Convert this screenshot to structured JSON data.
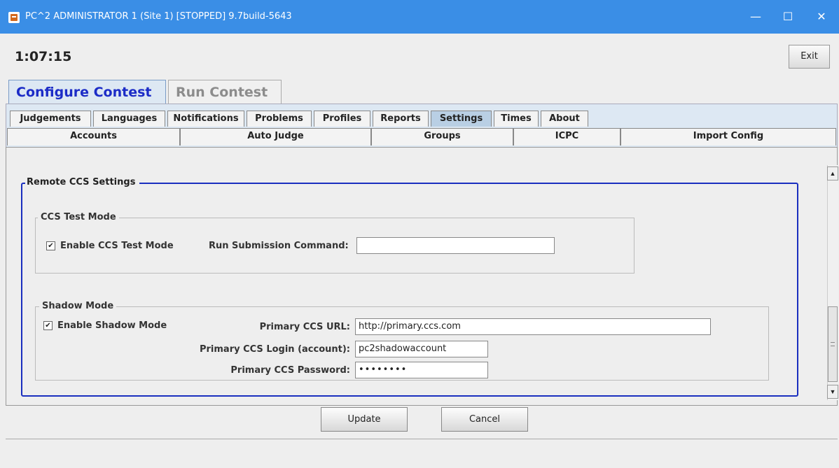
{
  "window": {
    "title": "PC^2 ADMINISTRATOR 1 (Site 1) [STOPPED] 9.7build-5643",
    "minimize": "—",
    "maximize": "☐",
    "close": "✕"
  },
  "clock": "1:07:15",
  "exit_label": "Exit",
  "main_tabs": [
    {
      "label": "Configure Contest",
      "active": true
    },
    {
      "label": "Run Contest",
      "active": false
    }
  ],
  "sub_tabs_row1": [
    {
      "label": "Judgements"
    },
    {
      "label": "Languages"
    },
    {
      "label": "Notifications"
    },
    {
      "label": "Problems"
    },
    {
      "label": "Profiles"
    },
    {
      "label": "Reports"
    },
    {
      "label": "Settings",
      "active": true
    },
    {
      "label": "Times"
    },
    {
      "label": "About"
    }
  ],
  "sub_tabs_row2": [
    {
      "label": "Accounts"
    },
    {
      "label": "Auto Judge"
    },
    {
      "label": "Groups"
    },
    {
      "label": "ICPC"
    },
    {
      "label": "Import Config"
    }
  ],
  "remote_ccs": {
    "title": "Remote CCS Settings",
    "test_mode": {
      "title": "CCS Test Mode",
      "enable_label": "Enable CCS Test Mode",
      "enabled": true,
      "run_submission_label": "Run Submission Command:",
      "run_submission_value": ""
    },
    "shadow_mode": {
      "title": "Shadow Mode",
      "enable_label": "Enable Shadow Mode",
      "enabled": true,
      "url_label": "Primary CCS URL:",
      "url_value": "http://primary.ccs.com",
      "login_label": "Primary CCS Login (account):",
      "login_value": "pc2shadowaccount",
      "password_label": "Primary CCS Password:",
      "password_value": "••••••••"
    }
  },
  "buttons": {
    "update": "Update",
    "cancel": "Cancel"
  },
  "colors": {
    "titlebar": "#3a8ee6",
    "active_tab_text": "#1c2cc7",
    "group_border_accent": "#1a2fbf"
  }
}
